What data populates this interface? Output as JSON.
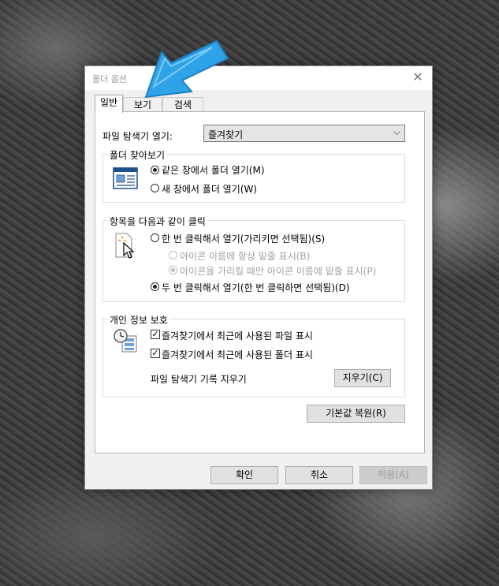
{
  "dialog": {
    "title": "폴더 옵션",
    "close_glyph": "✕",
    "tabs": [
      {
        "label": "일반",
        "active": true
      },
      {
        "label": "보기",
        "active": false
      },
      {
        "label": "검색",
        "active": false
      }
    ],
    "explorer_open": {
      "label": "파일 탐색기 열기:",
      "value": "즐겨찾기",
      "arrow_glyph": "⌵"
    },
    "browse_folders": {
      "legend": "폴더 찾아보기",
      "options": [
        {
          "label": "같은 창에서 폴더 열기(M)",
          "checked": true
        },
        {
          "label": "새 창에서 폴더 열기(W)",
          "checked": false
        }
      ]
    },
    "click_items": {
      "legend": "항목을 다음과 같이 클릭",
      "single_click": {
        "label": "한 번 클릭해서 열기(가리키면 선택됨)(S)",
        "checked": false
      },
      "underline_always": {
        "label": "아이콘 이름에 항상 밑줄 표시(B)",
        "checked": false,
        "enabled": false
      },
      "underline_hover": {
        "label": "아이콘을 가리킬 때만 아이콘 이름에 밑줄 표시(P)",
        "checked": true,
        "enabled": false
      },
      "double_click": {
        "label": "두 번 클릭해서 열기(한 번 클릭하면 선택됨)(D)",
        "checked": true
      }
    },
    "privacy": {
      "legend": "개인 정보 보호",
      "checks": [
        {
          "label": "즐겨찾기에서 최근에 사용된 파일 표시",
          "checked": true
        },
        {
          "label": "즐겨찾기에서 최근에 사용된 폴더 표시",
          "checked": true
        }
      ],
      "clear_label": "파일 탐색기 기록 지우기",
      "clear_button": "지우기(C)",
      "check_glyph": "✓"
    },
    "restore_defaults": "기본값 복원(R)",
    "footer": {
      "ok": "확인",
      "cancel": "취소",
      "apply": "적용(A)"
    }
  },
  "colors": {
    "arrow": "#2ea3e8",
    "dialog_bg": "#f0f0f0",
    "panel_bg": "#ffffff"
  }
}
